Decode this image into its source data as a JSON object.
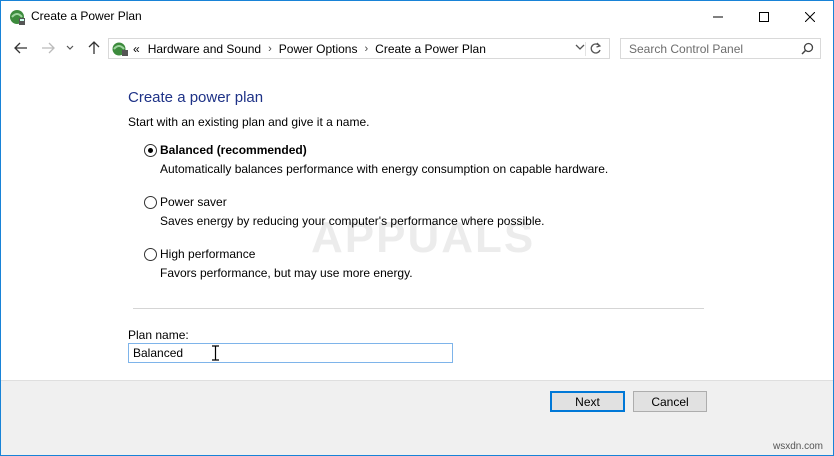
{
  "window": {
    "title": "Create a Power Plan",
    "controls": {
      "minimize": "minimize",
      "maximize": "maximize",
      "close": "close"
    }
  },
  "navigation": {
    "breadcrumb_prefix": "«",
    "breadcrumbs": [
      "Hardware and Sound",
      "Power Options",
      "Create a Power Plan"
    ],
    "separator": "›",
    "search_placeholder": "Search Control Panel"
  },
  "content": {
    "heading": "Create a power plan",
    "subtitle": "Start with an existing plan and give it a name.",
    "options": [
      {
        "label": "Balanced (recommended)",
        "description": "Automatically balances performance with energy consumption on capable hardware.",
        "selected": true
      },
      {
        "label": "Power saver",
        "description": "Saves energy by reducing your computer's performance where possible.",
        "selected": false
      },
      {
        "label": "High performance",
        "description": "Favors performance, but may use more energy.",
        "selected": false
      }
    ],
    "plan_name_label": "Plan name:",
    "plan_name_value": "Balanced"
  },
  "buttons": {
    "next": "Next",
    "cancel": "Cancel"
  },
  "watermark": "APPUALS",
  "corner_mark": "wsxdn.com",
  "colors": {
    "heading": "#1e3287",
    "accent": "#0078d7",
    "footer_bg": "#f0f0f0"
  }
}
